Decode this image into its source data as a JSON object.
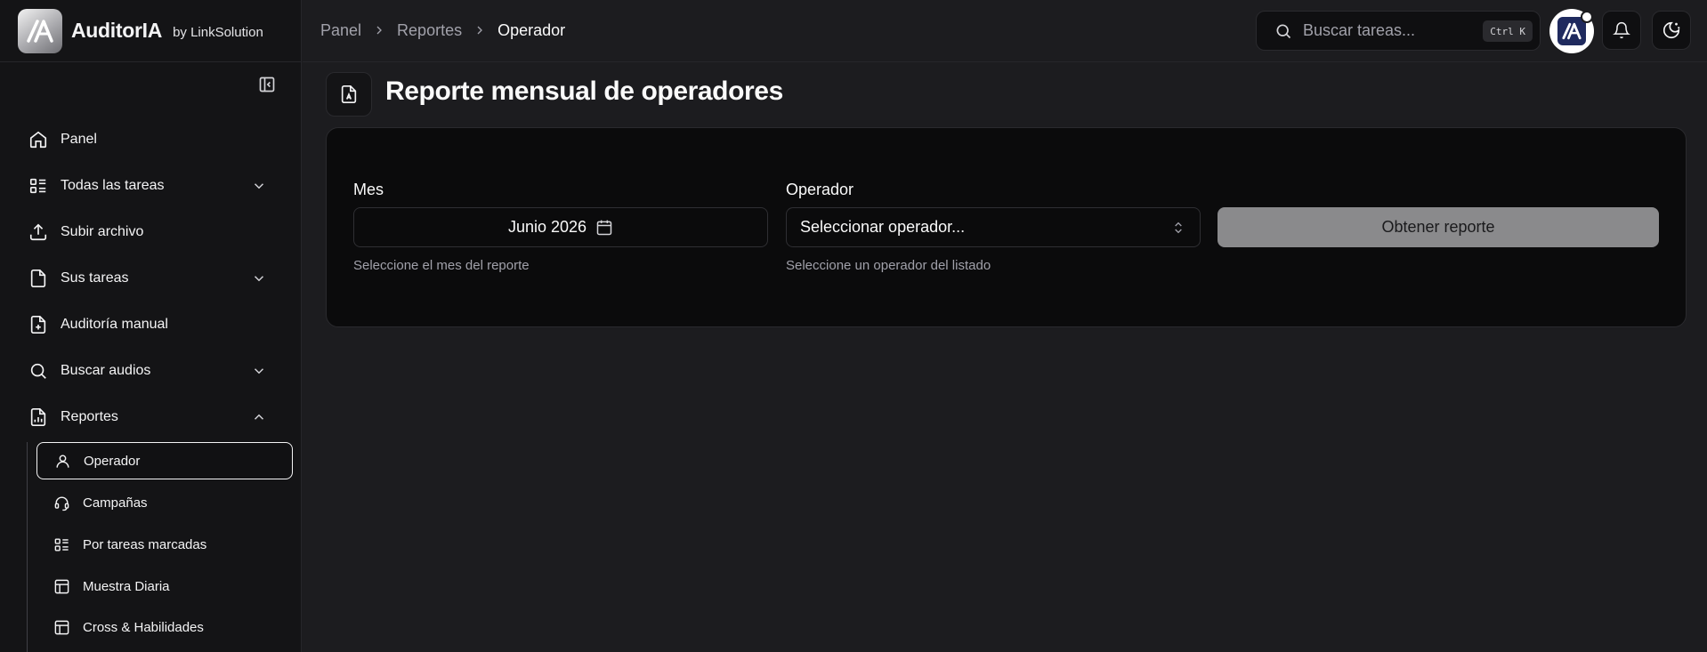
{
  "brand": {
    "name": "AuditorIA",
    "by": "by LinkSolution",
    "logo_text": "/A"
  },
  "sidebar": {
    "items": [
      {
        "label": "Panel",
        "icon": "home-icon",
        "expandable": false
      },
      {
        "label": "Todas las tareas",
        "icon": "list-icon",
        "expandable": true
      },
      {
        "label": "Subir archivo",
        "icon": "upload-icon",
        "expandable": false
      },
      {
        "label": "Sus tareas",
        "icon": "file-icon",
        "expandable": true
      },
      {
        "label": "Auditoría manual",
        "icon": "file-plus-icon",
        "expandable": false
      },
      {
        "label": "Buscar audios",
        "icon": "search-icon",
        "expandable": true
      },
      {
        "label": "Reportes",
        "icon": "file-chart-icon",
        "expandable": true,
        "expanded": true
      }
    ],
    "sub_items": [
      {
        "label": "Operador",
        "icon": "user-icon",
        "active": true
      },
      {
        "label": "Campañas",
        "icon": "headset-icon",
        "active": false
      },
      {
        "label": "Por tareas marcadas",
        "icon": "list-icon",
        "active": false
      },
      {
        "label": "Muestra Diaria",
        "icon": "table-icon",
        "active": false
      },
      {
        "label": "Cross & Habilidades",
        "icon": "table-icon",
        "active": false
      }
    ]
  },
  "breadcrumb": [
    "Panel",
    "Reportes",
    "Operador"
  ],
  "search": {
    "placeholder": "Buscar tareas...",
    "shortcut": "Ctrl K"
  },
  "page": {
    "title": "Reporte mensual de operadores",
    "month": {
      "label": "Mes",
      "value": "Junio 2026",
      "help": "Seleccione el mes del reporte"
    },
    "operator": {
      "label": "Operador",
      "placeholder": "Seleccionar operador...",
      "help": "Seleccione un operador del listado"
    },
    "submit_label": "Obtener reporte"
  },
  "colors": {
    "background": "#1c1c1f",
    "sidebar": "#141416",
    "card": "#0b0b0c",
    "button_disabled": "#8a8a8c",
    "avatar_brand": "#1f2a5e"
  }
}
